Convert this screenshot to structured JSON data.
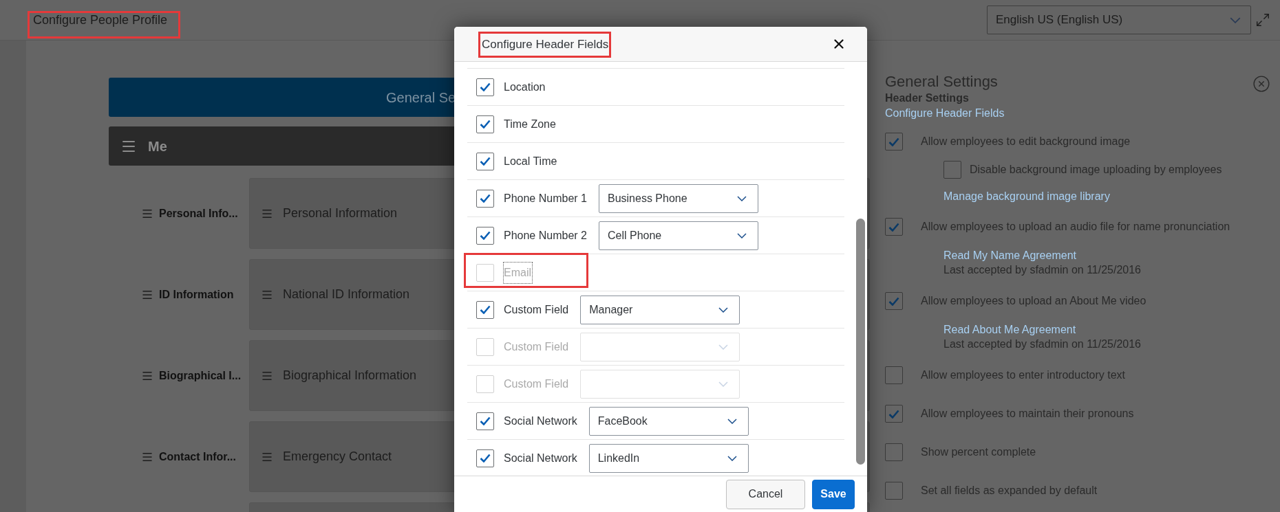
{
  "page": {
    "title": "Configure People Profile",
    "language": "English US (English US)"
  },
  "main": {
    "banner": "General Se",
    "section": "Me",
    "rows": [
      {
        "label": "Personal Info...",
        "card": "Personal Information"
      },
      {
        "label": "ID Information",
        "card": "National ID Information"
      },
      {
        "label": "Biographical I...",
        "card": "Biographical Information"
      },
      {
        "label": "Contact Infor...",
        "card": "Emergency Contact"
      }
    ]
  },
  "settings": {
    "title": "General Settings",
    "subtitle": "Header Settings",
    "link": "Configure Header Fields",
    "options": [
      {
        "label": "Allow employees to edit background image",
        "checked": true,
        "details": [
          {
            "kind": "checkbox",
            "label": "Disable background image uploading by employees",
            "checked": false
          },
          {
            "kind": "link",
            "text": "Manage background image library"
          }
        ]
      },
      {
        "label": "Allow employees to upload an audio file for name pronunciation",
        "checked": true,
        "details": [
          {
            "kind": "link",
            "text": "Read My Name Agreement"
          },
          {
            "kind": "note",
            "text": "Last accepted by sfadmin on 11/25/2016"
          }
        ]
      },
      {
        "label": "Allow employees to upload an About Me video",
        "checked": true,
        "details": [
          {
            "kind": "link",
            "text": "Read About Me Agreement"
          },
          {
            "kind": "note",
            "text": "Last accepted by sfadmin on 11/25/2016"
          }
        ]
      },
      {
        "label": "Allow employees to enter introductory text",
        "checked": false
      },
      {
        "label": "Allow employees to maintain their pronouns",
        "checked": true
      },
      {
        "label": "Show percent complete",
        "checked": false
      },
      {
        "label": "Set all fields as expanded by default",
        "checked": false
      }
    ]
  },
  "dialog": {
    "title": "Configure Header Fields",
    "fields": [
      {
        "label": "Location",
        "kind": "plain",
        "checked": true,
        "disabled": false,
        "focused": false
      },
      {
        "label": "Time Zone",
        "kind": "plain",
        "checked": true,
        "disabled": false,
        "focused": false
      },
      {
        "label": "Local Time",
        "kind": "plain",
        "checked": true,
        "disabled": false,
        "focused": false
      },
      {
        "label": "Phone Number 1",
        "kind": "select",
        "value": "Business Phone",
        "checked": true,
        "disabled": false,
        "focused": false
      },
      {
        "label": "Phone Number 2",
        "kind": "select",
        "value": "Cell Phone",
        "checked": true,
        "disabled": false,
        "focused": false
      },
      {
        "label": "Email",
        "kind": "plain",
        "checked": false,
        "disabled": true,
        "focused": true
      },
      {
        "label": "Custom Field",
        "kind": "select",
        "value": "Manager",
        "checked": true,
        "disabled": false,
        "focused": false
      },
      {
        "label": "Custom Field",
        "kind": "select",
        "checked": false,
        "disabled": true,
        "focused": false
      },
      {
        "label": "Custom Field",
        "kind": "select",
        "checked": false,
        "disabled": true,
        "focused": false
      },
      {
        "label": "Social Network",
        "kind": "select",
        "value": "FaceBook",
        "checked": true,
        "disabled": false,
        "focused": false
      },
      {
        "label": "Social Network",
        "kind": "select",
        "value": "LinkedIn",
        "checked": true,
        "disabled": false,
        "focused": false
      }
    ],
    "buttons": [
      {
        "label": "Cancel",
        "kind": "secondary"
      },
      {
        "label": "Save",
        "kind": "primary"
      }
    ]
  }
}
